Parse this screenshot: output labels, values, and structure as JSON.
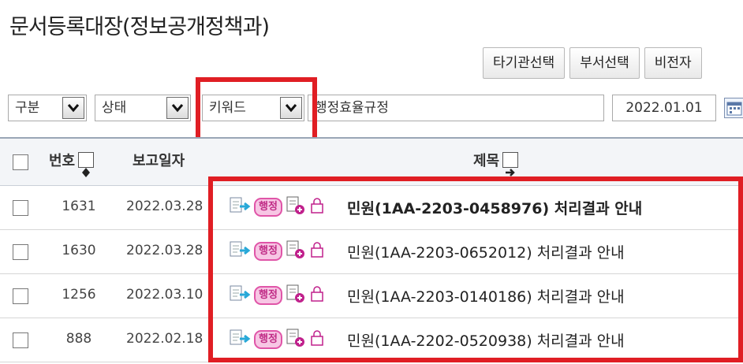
{
  "page_title": "문서등록대장(정보공개정책과)",
  "top_buttons": [
    "타기관선택",
    "부서선택",
    "비전자"
  ],
  "filters": {
    "category_label": "구분",
    "status_label": "상태",
    "search_type": "키워드",
    "keyword_value": "행정효율규정",
    "start_date": "2022.01.01"
  },
  "table": {
    "headers": {
      "number": "번호",
      "report_date": "보고일자",
      "title": "제목"
    },
    "badge_label": "행정",
    "rows": [
      {
        "number": "1631",
        "date": "2022.03.28",
        "subject": "민원(1AA-2203-0458976) 처리결과 안내",
        "bold": true
      },
      {
        "number": "1630",
        "date": "2022.03.28",
        "subject": "민원(1AA-2203-0652012) 처리결과 안내",
        "bold": false
      },
      {
        "number": "1256",
        "date": "2022.03.10",
        "subject": "민원(1AA-2203-0140186) 처리결과 안내",
        "bold": false
      },
      {
        "number": "888",
        "date": "2022.02.18",
        "subject": "민원(1AA-2202-0520938) 처리결과 안내",
        "bold": false
      }
    ]
  },
  "colors": {
    "highlight": "#e01e24",
    "badge_border": "#e055a8",
    "badge_fill": "#f7c6e4"
  }
}
